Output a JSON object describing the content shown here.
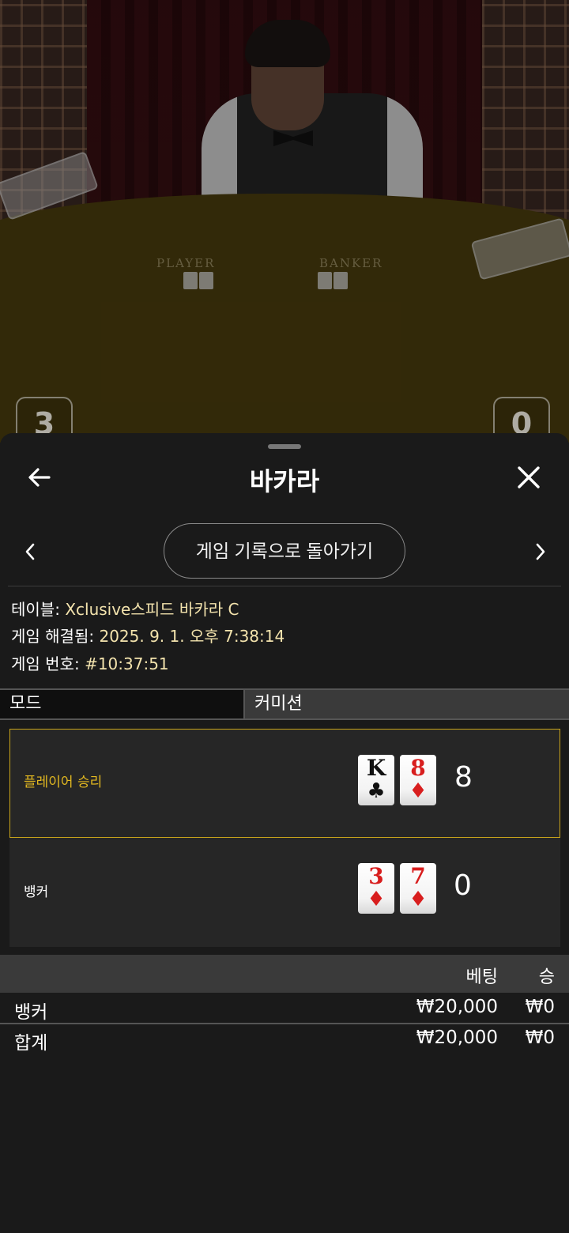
{
  "video": {
    "table_labels": [
      "PLAYER",
      "BANKER"
    ],
    "player_score": "3",
    "banker_score": "0"
  },
  "sheet": {
    "title": "바카라",
    "back_icon": "arrow-left-icon",
    "close_icon": "close-icon",
    "history_button": "게임 기록으로 돌아가기"
  },
  "info": {
    "table_key": "테이블:",
    "table_value": "Xclusive스피드 바카라 C",
    "resolved_key": "게임 해결됨:",
    "resolved_value": "2025. 9. 1. 오후 7:38:14",
    "number_key": "게임 번호:",
    "number_value": "#10:37:51"
  },
  "mode": {
    "col1": "모드",
    "col2": "커미션"
  },
  "results": [
    {
      "label": "플레이어 승리",
      "winner": true,
      "cards": [
        {
          "rank": "K",
          "suit": "♣",
          "color": "black"
        },
        {
          "rank": "8",
          "suit": "♦",
          "color": "red"
        }
      ],
      "score": "8"
    },
    {
      "label": "뱅커",
      "winner": false,
      "cards": [
        {
          "rank": "3",
          "suit": "♦",
          "color": "red"
        },
        {
          "rank": "7",
          "suit": "♦",
          "color": "red"
        }
      ],
      "score": "0"
    }
  ],
  "bets": {
    "header_bet": "베팅",
    "header_win": "승",
    "rows": [
      {
        "name": "뱅커",
        "bet": "₩20,000",
        "win": "₩0"
      },
      {
        "name": "합계",
        "bet": "₩20,000",
        "win": "₩0"
      }
    ]
  },
  "colors": {
    "accent_gold": "#c9a51b",
    "winner_text": "#e2b820",
    "info_value": "#f3e3ad"
  }
}
